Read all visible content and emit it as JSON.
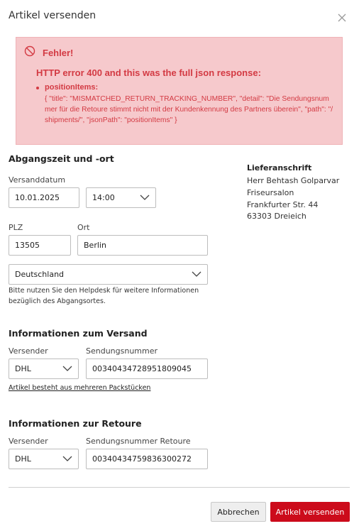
{
  "dialog": {
    "title": "Artikel versenden"
  },
  "error": {
    "title": "Fehler!",
    "heading": "HTTP error 400 and this was the full json response:",
    "item_title": "positionItems:",
    "item_detail": "{ \"title\": \"MISMATCHED_RETURN_TRACKING_NUMBER\", \"detail\": \"Die Sendungsnummer für die Retoure stimmt nicht mit der Kundenkennung des Partners überein\", \"path\": \"/shipments/\", \"jsonPath\": \"positionItems\" }",
    "color": "#d33a43",
    "background": "#f6c9cc"
  },
  "departure": {
    "heading": "Abgangszeit und -ort",
    "date_label": "Versanddatum",
    "date_value": "10.01.2025",
    "time_value": "14:00",
    "zip_label": "PLZ",
    "zip_value": "13505",
    "city_label": "Ort",
    "city_value": "Berlin",
    "country_value": "Deutschland",
    "hint": "Bitte nutzen Sie den Helpdesk für weitere Informationen bezüglich des Abgangsortes."
  },
  "address": {
    "heading": "Lieferanschrift",
    "lines": [
      "Herr Behtash Golparvar",
      "Friseursalon",
      "Frankfurter Str. 44",
      "63303 Dreieich"
    ]
  },
  "shipping": {
    "heading": "Informationen zum Versand",
    "carrier_label": "Versender",
    "carrier_value": "DHL",
    "tracking_label": "Sendungsnummer",
    "tracking_value": "00340434728951809045",
    "multi_package_link": "Artikel besteht aus mehreren Packstücken"
  },
  "return": {
    "heading": "Informationen zur Retoure",
    "carrier_label": "Versender",
    "carrier_value": "DHL",
    "tracking_label": "Sendungsnummer Retoure",
    "tracking_value": "00340434759836300272"
  },
  "footer": {
    "cancel_label": "Abbrechen",
    "submit_label": "Artikel versenden",
    "submit_color": "#cc0b1b"
  }
}
